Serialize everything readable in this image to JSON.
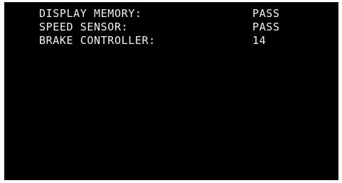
{
  "diagnostics": {
    "rows": [
      {
        "label": "DISPLAY MEMORY:",
        "value": "PASS"
      },
      {
        "label": "SPEED SENSOR:",
        "value": "PASS"
      },
      {
        "label": "BRAKE CONTROLLER:",
        "value": "14"
      }
    ]
  },
  "colors": {
    "screen_background": "#000000",
    "text": "#f2f2f2",
    "frame": "#ffffff"
  }
}
